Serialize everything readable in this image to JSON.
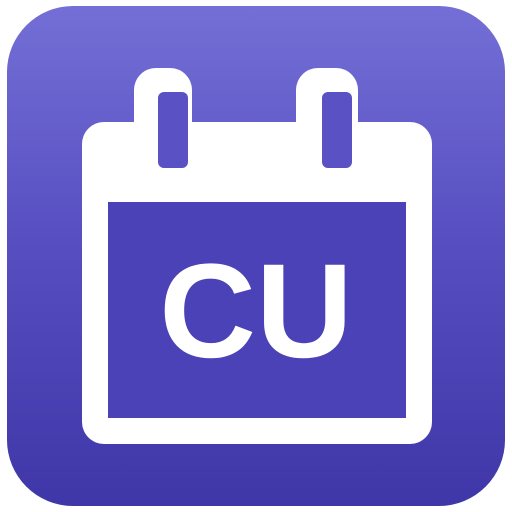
{
  "icon": {
    "name": "calendar-icon",
    "text": "CU",
    "colors": {
      "gradient_top": "#746fd6",
      "gradient_mid": "#5850c2",
      "gradient_bottom": "#3f36a8",
      "foreground": "#ffffff",
      "inner_panel": "#4a42b6"
    }
  }
}
